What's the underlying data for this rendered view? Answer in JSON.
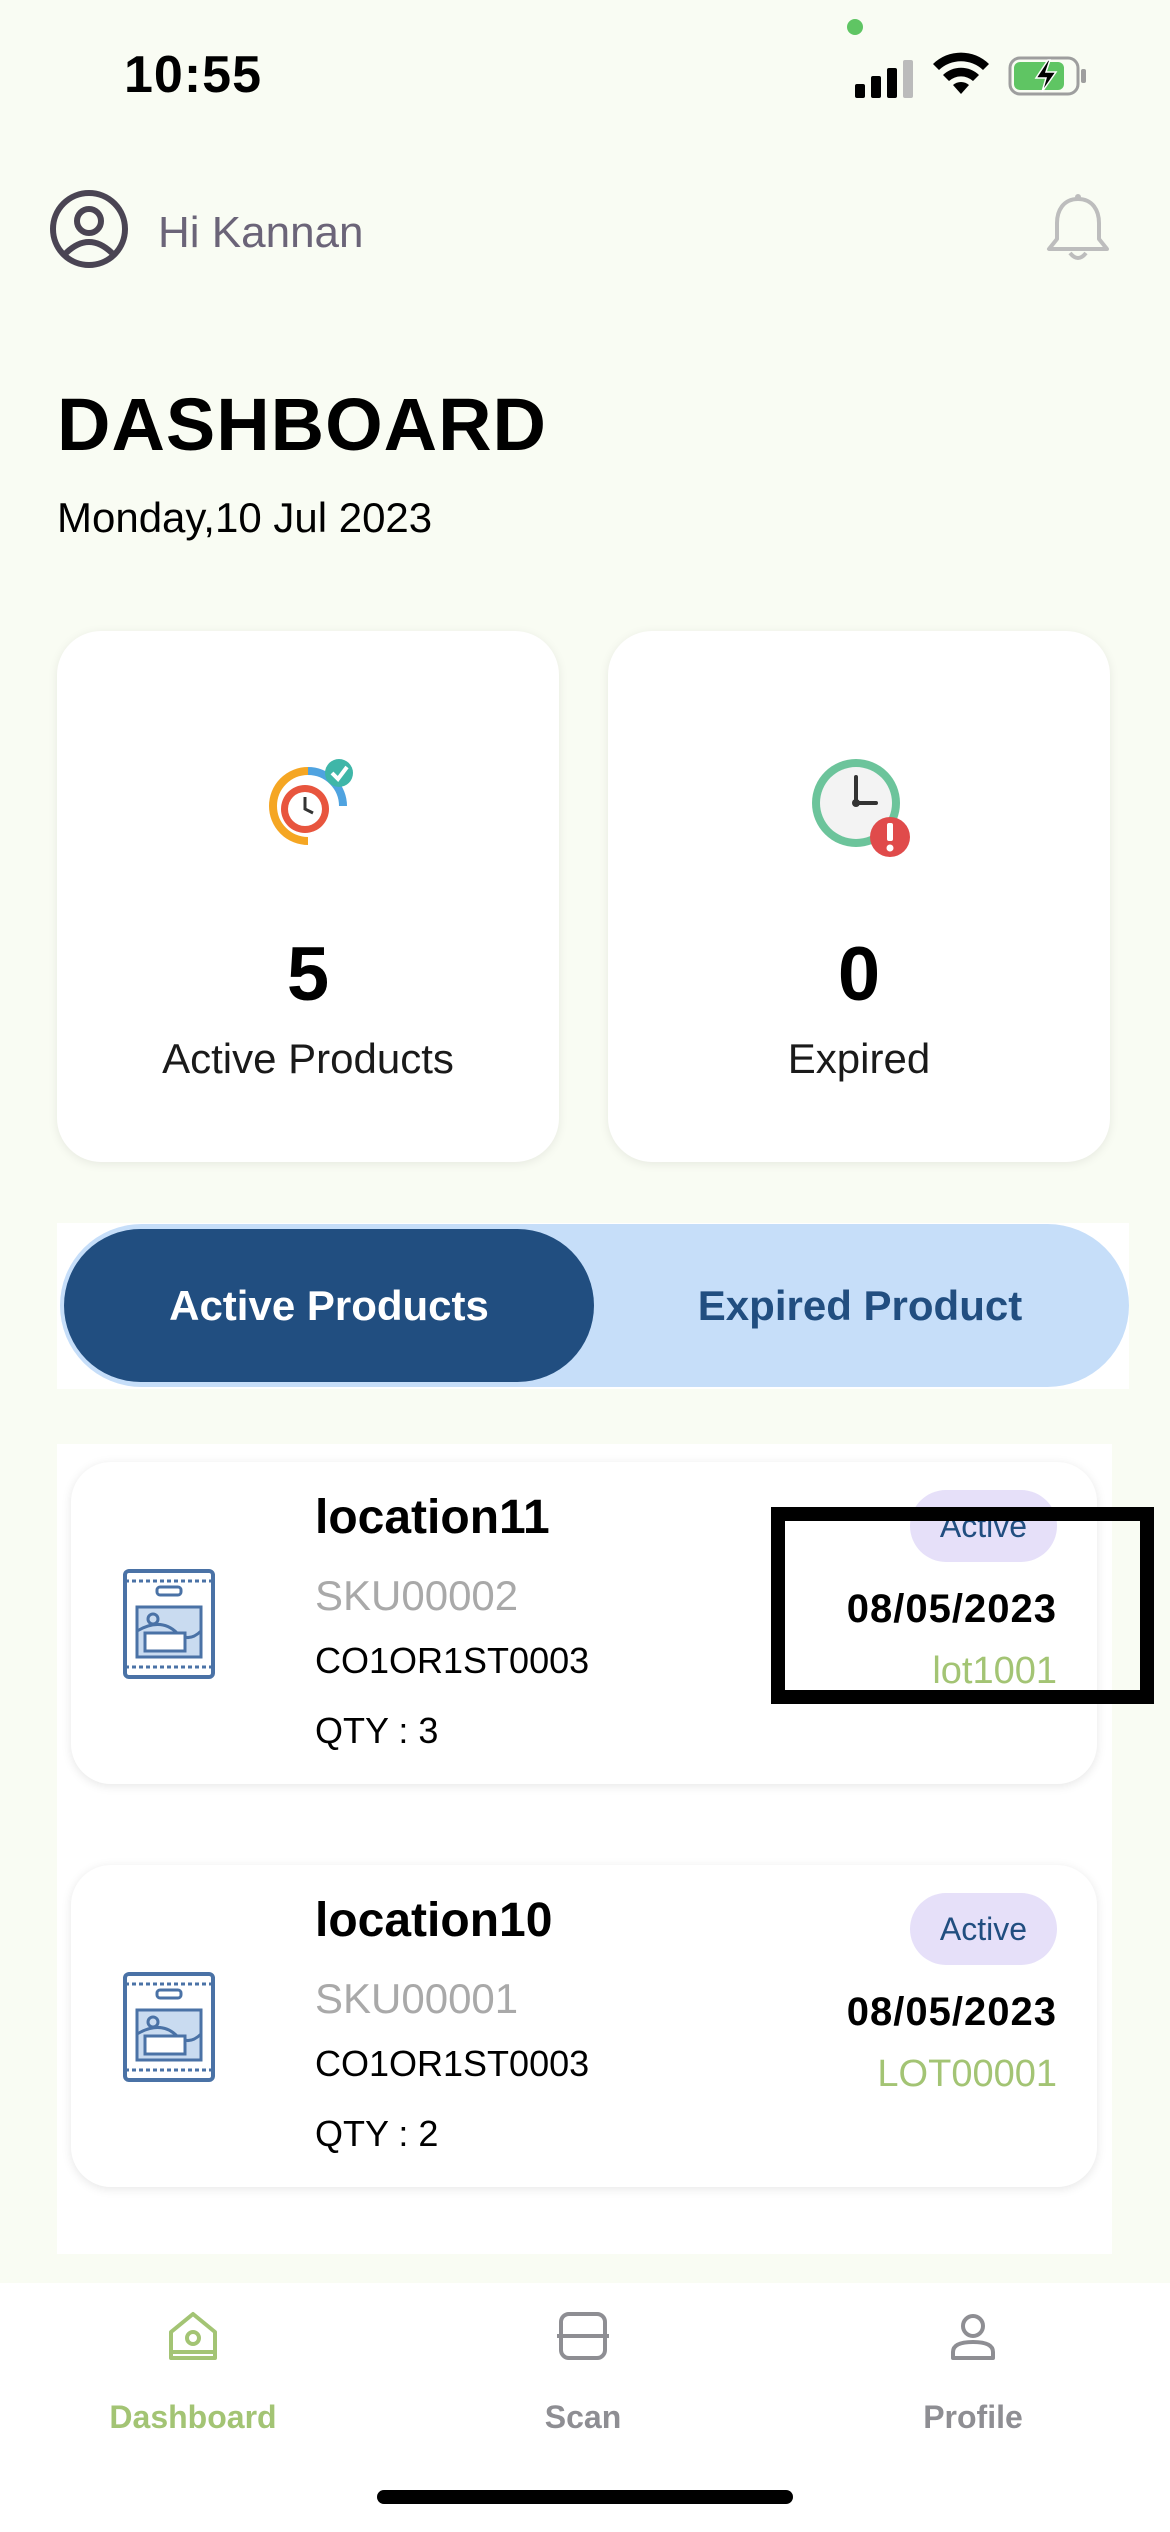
{
  "status_bar": {
    "time": "10:55"
  },
  "header": {
    "greeting": "Hi Kannan",
    "title": "DASHBOARD",
    "date": "Monday,10 Jul 2023"
  },
  "stats": {
    "active": {
      "value": "5",
      "label": "Active Products"
    },
    "expired": {
      "value": "0",
      "label": "Expired"
    }
  },
  "tabs": {
    "active_label": "Active Products",
    "expired_label": "Expired Product"
  },
  "products": [
    {
      "location": "location11",
      "sku": "SKU00002",
      "code": "CO1OR1ST0003",
      "qty": "QTY : 3",
      "status": "Active",
      "date": "08/05/2023",
      "lot": "lot1001"
    },
    {
      "location": "location10",
      "sku": "SKU00001",
      "code": "CO1OR1ST0003",
      "qty": "QTY : 2",
      "status": "Active",
      "date": "08/05/2023",
      "lot": "LOT00001"
    }
  ],
  "bottom_nav": {
    "items": [
      {
        "label": "Dashboard",
        "icon": "home-icon"
      },
      {
        "label": "Scan",
        "icon": "scan-icon"
      },
      {
        "label": "Profile",
        "icon": "profile-icon"
      }
    ]
  },
  "colors": {
    "background": "#f9fcf3",
    "primary": "#214e80",
    "tab_bg": "#c6def9",
    "nav_active": "#a3c474",
    "nav_inactive": "#8e8e93",
    "badge_bg": "#e6e0f9"
  }
}
